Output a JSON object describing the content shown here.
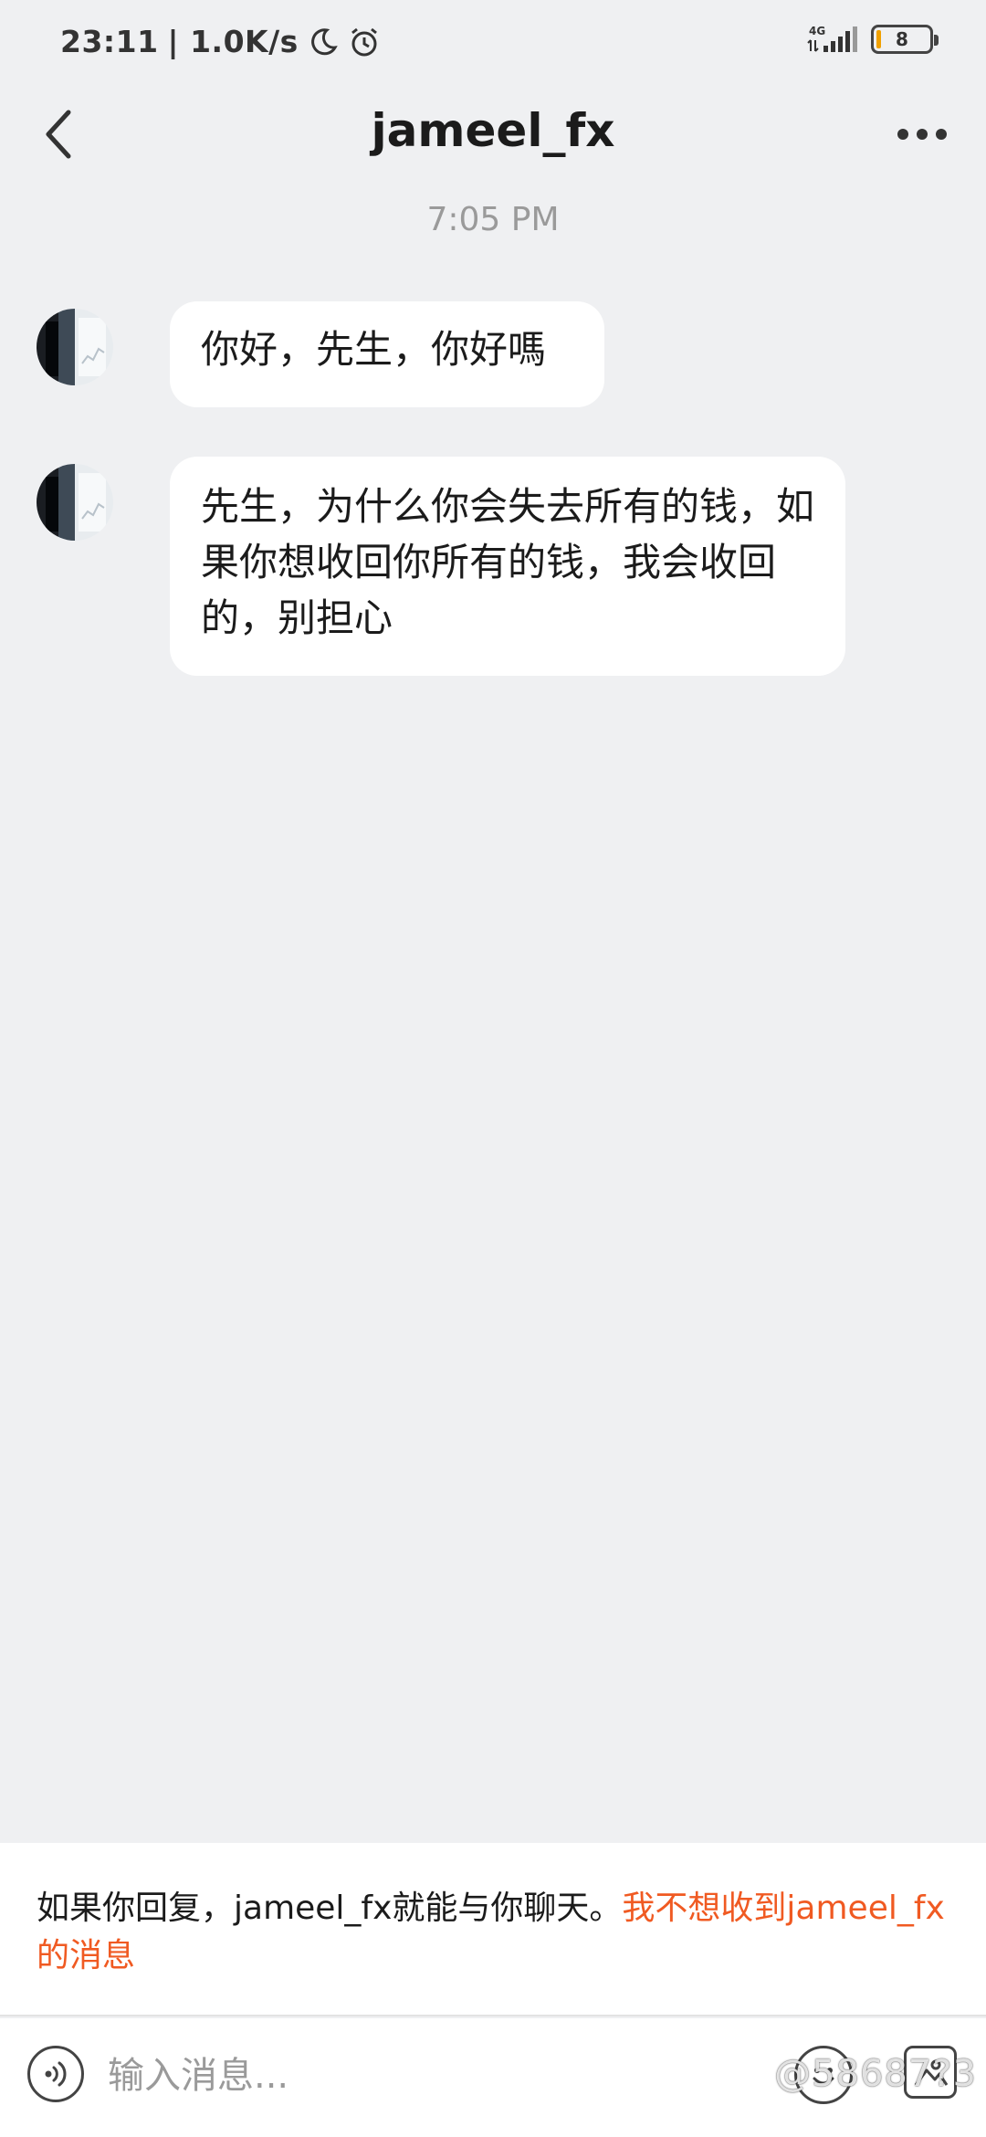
{
  "status_bar": {
    "time": "23:11",
    "network_speed": "| 1.0K/s",
    "network_type": "4G",
    "battery_level": "8",
    "icons": [
      "moon-icon",
      "alarm-icon",
      "signal-icon",
      "battery-icon"
    ]
  },
  "header": {
    "title": "jameel_fx",
    "back_icon": "chevron-left-icon",
    "more_icon": "more-dots-icon"
  },
  "chat": {
    "timestamp": "7:05 PM",
    "messages": [
      {
        "text": "你好，先生，你好嗎"
      },
      {
        "text": "先生，为什么你会失去所有的钱，如果你想收回你所有的钱，我会收回的，别担心"
      }
    ]
  },
  "notice": {
    "text": "如果你回复，jameel_fx就能与你聊天。",
    "link": "我不想收到jameel_fx的消息"
  },
  "input_bar": {
    "placeholder": "输入消息...",
    "voice_icon": "voice-icon",
    "emoji_icon": "emoji-icon",
    "image_icon": "image-icon"
  },
  "watermark": "@58687?3",
  "colors": {
    "background": "#eff0f2",
    "bubble": "#ffffff",
    "accent_link": "#f05a22",
    "timestamp": "#9a9a9a"
  }
}
